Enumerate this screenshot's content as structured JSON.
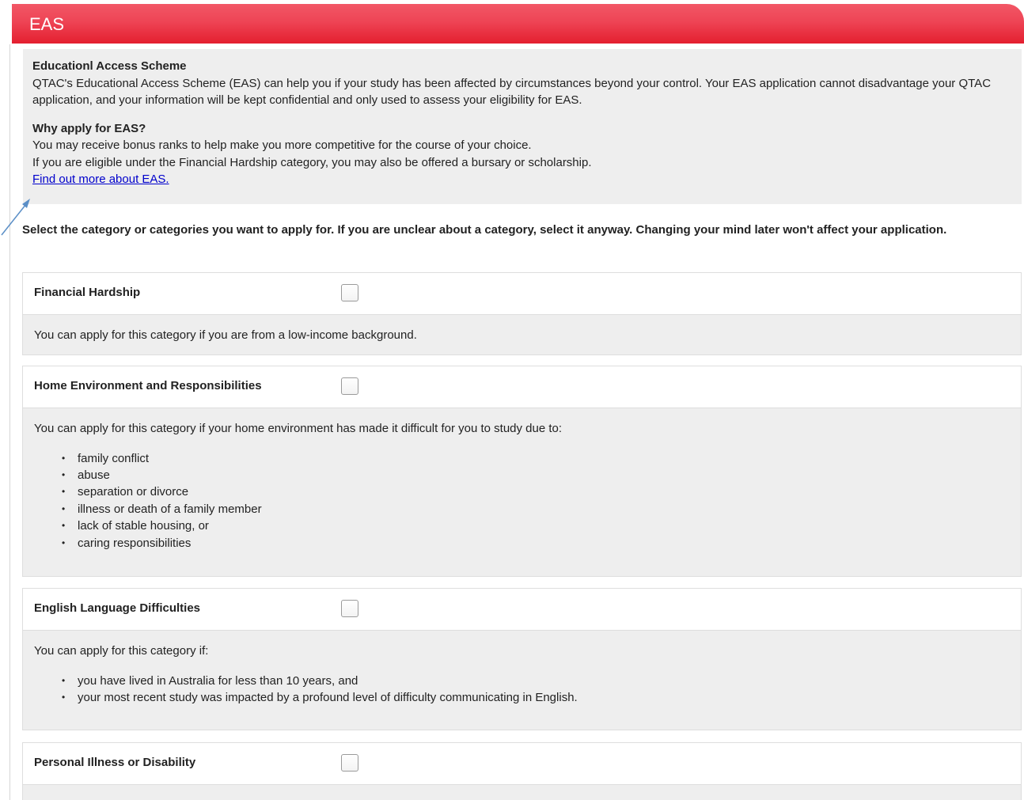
{
  "header": {
    "title": "EAS"
  },
  "intro": {
    "heading": "Educationl Access Scheme",
    "description": "QTAC's Educational Access Scheme (EAS) can help you if your study has been affected by circumstances beyond your control. Your EAS application cannot disadvantage your QTAC application, and your information will be kept confidential and only used to assess your eligibility for EAS.",
    "why_heading": "Why apply for EAS?",
    "why_line1": "You may receive bonus ranks to help make you more competitive for the course of your choice.",
    "why_line2": "If you are eligible under the Financial Hardship category, you may also be offered a bursary or scholarship.",
    "link_text": "Find out more about EAS."
  },
  "select_prompt": "Select the category or categories you want to apply for. If you are unclear about a category, select it anyway. Changing your mind later won't affect your application.",
  "categories": [
    {
      "title": "Financial Hardship",
      "checked": false,
      "description": "You can apply for this category if you are from a low-income background.",
      "bullets": []
    },
    {
      "title": "Home Environment and Responsibilities",
      "checked": false,
      "description": "You can apply for this category if your home environment has made it difficult for you to study due to:",
      "bullets": [
        "family conflict",
        "abuse",
        "separation or divorce",
        "illness or death of a family member",
        "lack of stable housing, or",
        "caring responsibilities"
      ]
    },
    {
      "title": "English Language Difficulties",
      "checked": false,
      "description": "You can apply for this category if:",
      "bullets": [
        "you have lived in Australia for less than 10 years, and",
        "your most recent study was impacted by a profound level of difficulty communicating in English."
      ]
    },
    {
      "title": "Personal Illness or Disability",
      "checked": false,
      "description": "",
      "bullets": []
    }
  ],
  "colors": {
    "header_red": "#e41f2f",
    "panel_grey": "#eeeeee",
    "link_blue": "#0000cc",
    "annotation_arrow": "#5b8fc7"
  }
}
